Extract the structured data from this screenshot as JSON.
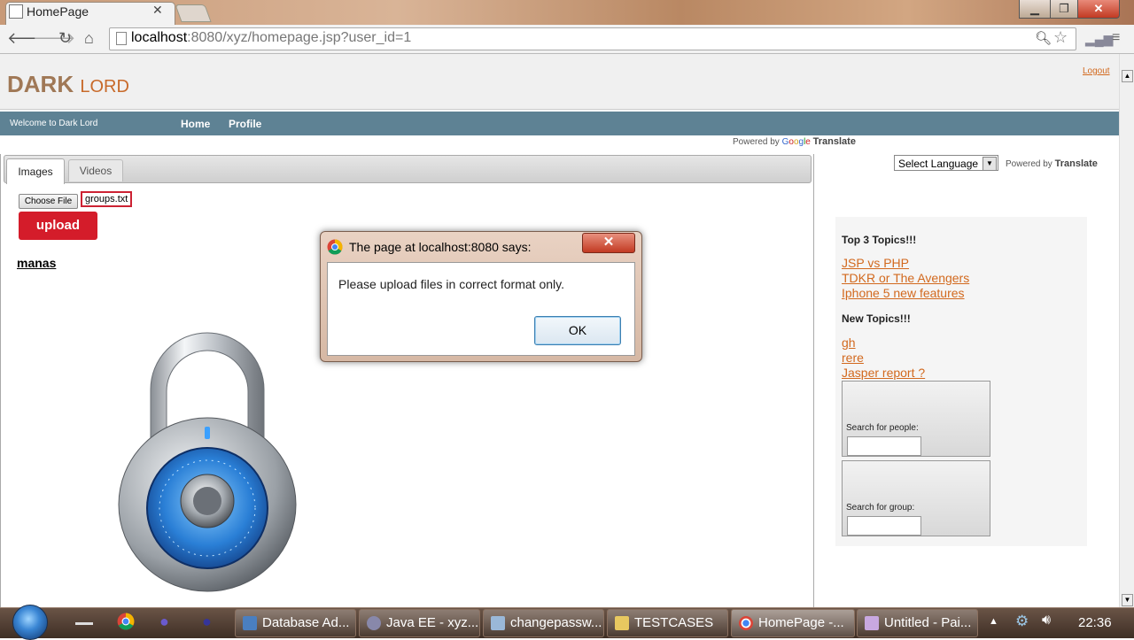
{
  "browser": {
    "tab_title": "HomePage",
    "url_host": "localhost",
    "url_rest": ":8080/xyz/homepage.jsp?user_id=1"
  },
  "header": {
    "logo_word1": "DARK",
    "logo_word2": "LORD",
    "logout": "Logout"
  },
  "navbar": {
    "welcome": "Welcome to Dark Lord",
    "home": "Home",
    "profile": "Profile"
  },
  "translate": {
    "powered_by": "Powered by",
    "google_g1": "G",
    "google_o1": "o",
    "google_o2": "o",
    "google_g2": "g",
    "google_l": "l",
    "google_e": "e",
    "translate": "Translate",
    "select_language": "Select Language"
  },
  "tabs": {
    "images": "Images",
    "videos": "Videos"
  },
  "upload_form": {
    "choose_file": "Choose File",
    "file_name": "groups.txt",
    "upload": "upload",
    "username": "manas"
  },
  "sidebar": {
    "top3_title": "Top 3 Topics!!!",
    "top3": [
      "JSP vs PHP",
      "TDKR or The Avengers",
      "Iphone 5 new features"
    ],
    "new_title": "New Topics!!!",
    "new": [
      "gh",
      "rere",
      "Jasper report ?"
    ],
    "search_people": "Search for people:",
    "search_group": "Search for group:"
  },
  "dialog": {
    "title": "The page at localhost:8080 says:",
    "message": "Please upload files in correct format only.",
    "ok": "OK",
    "close": "✕"
  },
  "taskbar": {
    "tasks": [
      "Database Ad...",
      "Java EE - xyz...",
      "changepassw...",
      "TESTCASES",
      "HomePage -...",
      "Untitled - Pai..."
    ],
    "clock": "22:36"
  },
  "icons": {
    "back": "back-arrow-icon",
    "forward": "forward-arrow-icon",
    "reload": "reload-icon",
    "home": "home-icon",
    "star": "bookmark-star-icon",
    "lock": "padlock-image"
  },
  "colors": {
    "accent_orange": "#d2691e",
    "navbar": "#5e8294",
    "upload_button": "#d41c2a"
  }
}
